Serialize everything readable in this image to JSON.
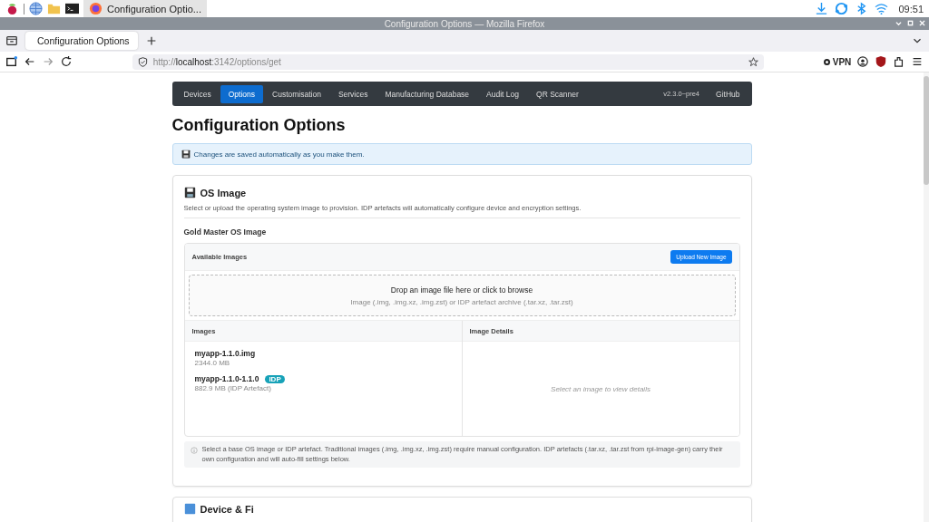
{
  "taskbar": {
    "app_title": "Configuration Optio...",
    "clock": "09:51"
  },
  "window": {
    "title": "Configuration Options — Mozilla Firefox"
  },
  "browser": {
    "tab_title": "Configuration Options",
    "url_scheme": "http://",
    "url_host": "localhost",
    "url_path": ":3142/options/get",
    "vpn_label": "VPN"
  },
  "nav": {
    "items": [
      {
        "label": "Devices",
        "selected": false
      },
      {
        "label": "Options",
        "selected": true
      },
      {
        "label": "Customisation",
        "selected": false
      },
      {
        "label": "Services",
        "selected": false
      },
      {
        "label": "Manufacturing Database",
        "selected": false
      },
      {
        "label": "Audit Log",
        "selected": false
      },
      {
        "label": "QR Scanner",
        "selected": false
      }
    ],
    "version": "v2.3.0~pre4",
    "github": "GitHub"
  },
  "page": {
    "title": "Configuration Options",
    "alert": "Changes are saved automatically as you make them."
  },
  "os_image": {
    "title": "OS Image",
    "description": "Select or upload the operating system image to provision. IDP artefacts will automatically configure device and encryption settings.",
    "subtitle": "Gold Master OS Image",
    "panel_title": "Available Images",
    "upload_button": "Upload New Image",
    "drop_text": "Drop an image file here or click to browse",
    "drop_hint": "Image (.img, .img.xz, .img.zst) or IDP artefact archive (.tar.xz, .tar.zst)",
    "columns": [
      "Images",
      "Image Details"
    ],
    "images": [
      {
        "name": "myapp-1.1.0.img",
        "size": "2344.0 MB"
      },
      {
        "name": "myapp-1.1.0-1.1.0",
        "size": "882.9 MB (IDP Artefact)",
        "badge": "IDP"
      }
    ],
    "details_placeholder": "Select an image to view details",
    "note": "Select a base OS image or IDP artefact. Traditional images (.img, .img.xz, .img.zst) require manual configuration. IDP artefacts (.tar.xz, .tar.zst from rpi-image-gen) carry their own configuration and will auto-fill settings below."
  },
  "next_section": {
    "title": "Device & Fi"
  }
}
